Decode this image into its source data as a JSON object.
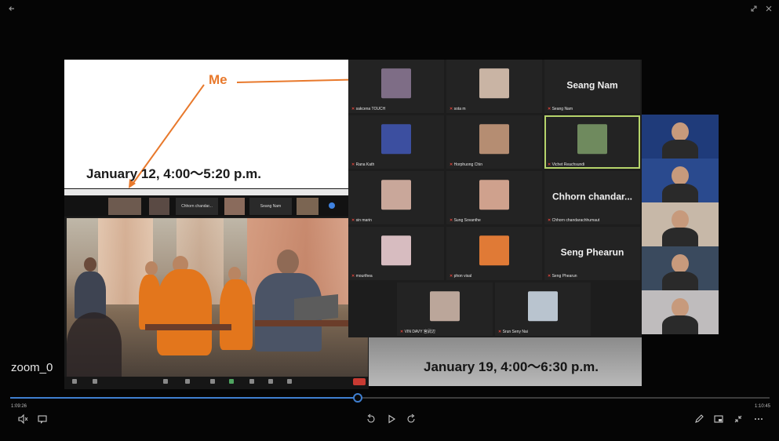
{
  "window": {
    "back_icon": "arrow-left-icon",
    "expand_icon": "expand-icon",
    "close_icon": "close-icon"
  },
  "slide": {
    "me_label": "Me",
    "date1": "January 12, 4:00～5:20 p.m.",
    "date2": "January 19, 4:00～6:30 p.m.",
    "accent": "#e8792c"
  },
  "inner_meeting": {
    "strip": [
      "",
      "",
      "Chhorn  chandar...",
      "",
      "Seang Nam",
      ""
    ],
    "strip_sub": [
      "",
      "",
      "Chhorn chandarachhumaut",
      "",
      "Seang Nam",
      ""
    ]
  },
  "grid": {
    "tiles": [
      {
        "name": "sakcena TOUCH",
        "type": "video",
        "color": "#7e6d86"
      },
      {
        "name": "sota m",
        "type": "video",
        "color": "#c9b4a4"
      },
      {
        "name": "Seang Nam",
        "type": "name",
        "big": "Seang Nam"
      },
      {
        "name": "Rana Kath",
        "type": "video",
        "color": "#3c4fa0"
      },
      {
        "name": "Horphuong Chin",
        "type": "video",
        "color": "#b58d72"
      },
      {
        "name": "Vichet Reachsundi",
        "type": "video",
        "color": "#6f8a5e",
        "active": true
      },
      {
        "name": "sin marin",
        "type": "video",
        "color": "#c9a79a"
      },
      {
        "name": "Sung Sovanthe",
        "type": "video",
        "color": "#cfa18d"
      },
      {
        "name": "Chhorn chandarachhumaut",
        "type": "name",
        "big": "Chhorn  chandar..."
      },
      {
        "name": "mourthea",
        "type": "video",
        "color": "#d7bcc0"
      },
      {
        "name": "phon visal",
        "type": "video",
        "color": "#e07a36"
      },
      {
        "name": "Seng Phearun",
        "type": "name",
        "big": "Seng Phearun"
      },
      {
        "name": "VIN DAVY 宮武辺",
        "type": "video",
        "color": "#bba69a"
      },
      {
        "name": "Srun Seny Nai",
        "type": "video",
        "color": "#b9c4cf"
      }
    ]
  },
  "right_column": {
    "cells": [
      {
        "color": "#1f3b7a"
      },
      {
        "color": "#2a4a8e"
      },
      {
        "color": "#c7b8a8"
      },
      {
        "color": "#3a4a5e"
      },
      {
        "color": "#bfbcbd"
      }
    ]
  },
  "player": {
    "overlay_label": "zoom_0",
    "time_current": "1:09:26",
    "time_total": "1:10:45",
    "progress": 0.458,
    "accent": "#3f7fd0",
    "left_controls": [
      "volume-icon",
      "captions-icon"
    ],
    "center_controls": [
      "rewind-10-icon",
      "play-icon",
      "forward-30-icon"
    ],
    "right_controls": [
      "pen-icon",
      "miniplayer-icon",
      "fullscreen-exit-icon",
      "more-icon"
    ]
  }
}
